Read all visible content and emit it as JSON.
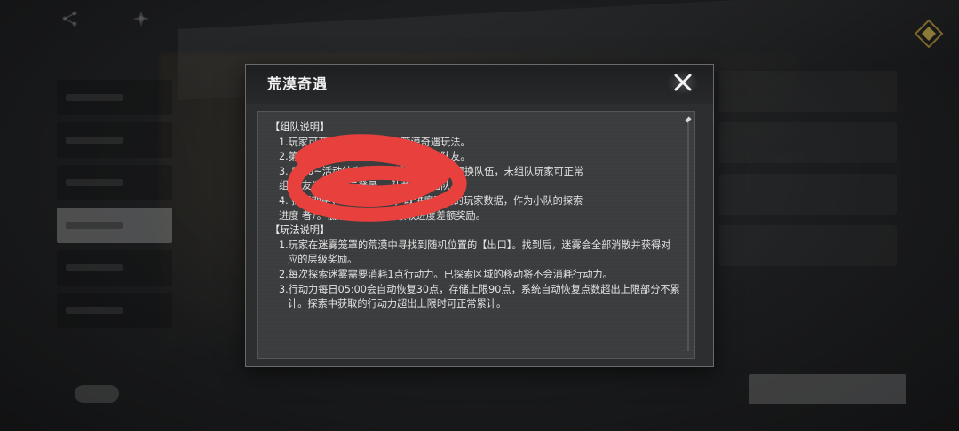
{
  "modal": {
    "title": "荒漠奇遇",
    "close_icon": "close-x-icon"
  },
  "rules": {
    "team_heading": "【组队说明】",
    "team_items": [
      "1.玩家可两人组队，                    人参与荒漠奇遇玩法。",
      "2.第一                                       、玩家可自行组队、随意更换队友。",
      "3.        5:00~活动结束为探索        组队玩家不可更换队伍，未组队玩家可正常",
      "组        队友连续3天未登录，               队并重新组队。",
      "4.        探索期中，组队                进度时，取进度更高的玩家数据，作为小队的探索",
      "进度                                  者）。低进度玩家直接领取进度差额奖励。"
    ],
    "play_heading": "【玩法说明】",
    "play_items": [
      "1.玩家在迷雾笼罩的荒漠中寻找到随机位置的【出口】。找到后，迷雾会全部消散并获得对应的层级奖励。",
      "2.每次探索迷雾需要消耗1点行动力。已探索区域的移动将不会消耗行动力。",
      "3.行动力每日05:00会自动恢复30点，存储上限90点，系统自动恢复点数超出上限部分不累计。探索中获取的行动力超出上限时可正常累计。"
    ]
  },
  "background": {
    "top_icons": [
      "share-icon",
      "compass-icon"
    ],
    "badge_icon": "gold-diamond-icon"
  },
  "colors": {
    "scribble": "#e8403d",
    "panel": "#3b3c3e",
    "header": "#1e1f21"
  }
}
